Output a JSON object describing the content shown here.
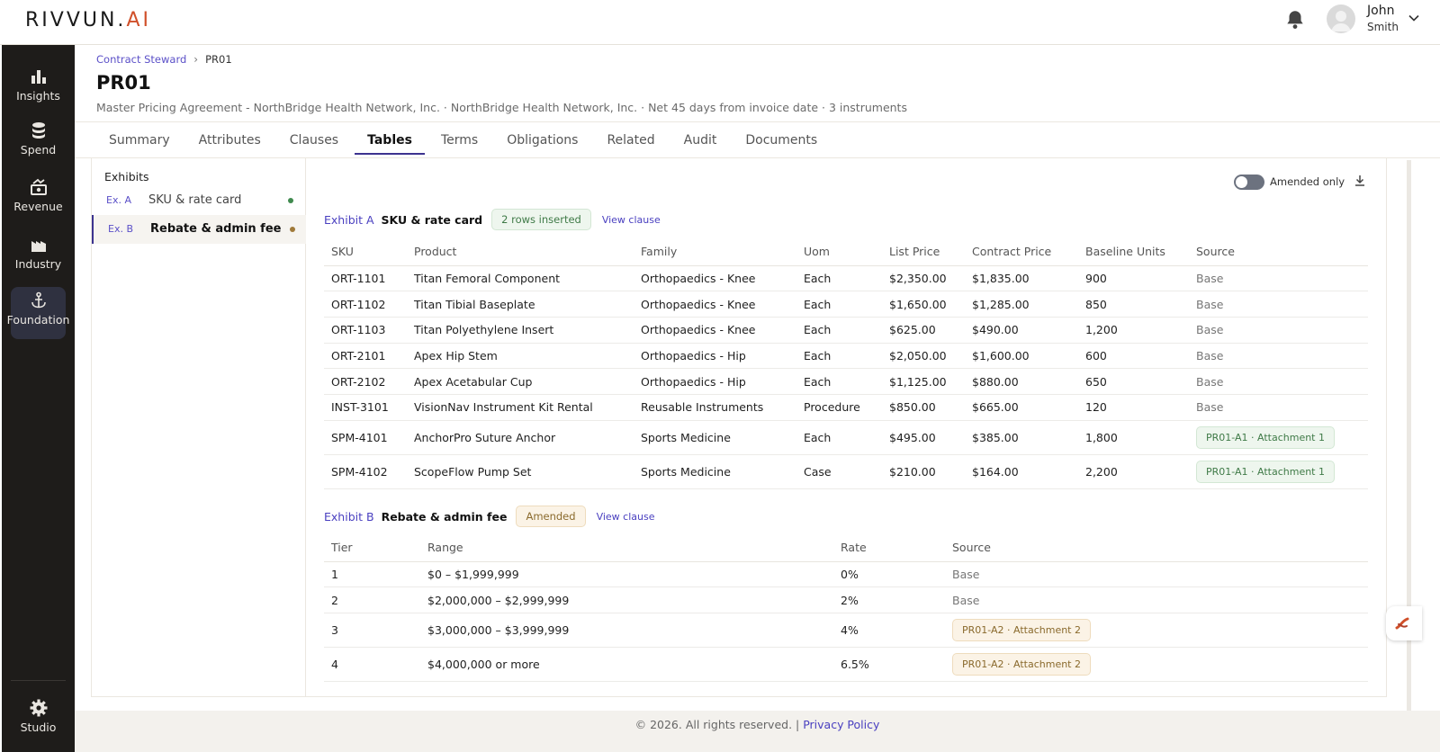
{
  "app": {
    "logo_main": "RIVVUN.",
    "logo_accent": "AI"
  },
  "user": {
    "first_name": "John",
    "last_name": "Smith"
  },
  "nav": {
    "items": [
      {
        "label": "Insights",
        "icon": "bar-chart-icon"
      },
      {
        "label": "Spend",
        "icon": "coins-icon"
      },
      {
        "label": "Revenue",
        "icon": "revenue-icon"
      },
      {
        "label": "Industry",
        "icon": "factory-icon"
      },
      {
        "label": "Foundation",
        "icon": "anchor-icon",
        "active": true
      }
    ],
    "studio_label": "Studio"
  },
  "breadcrumb": {
    "parent": "Contract Steward",
    "current": "PR01"
  },
  "page": {
    "title": "PR01",
    "subtitle": "Master Pricing Agreement - NorthBridge Health Network, Inc. · NorthBridge Health Network, Inc. · Net 45 days from invoice date · 3 instruments"
  },
  "tabs": [
    "Summary",
    "Attributes",
    "Clauses",
    "Tables",
    "Terms",
    "Obligations",
    "Related",
    "Audit",
    "Documents"
  ],
  "active_tab": "Tables",
  "exhibits": {
    "title": "Exhibits",
    "items": [
      {
        "code": "Ex. A",
        "name": "SKU & rate card",
        "dot_color": "#3f8a4e"
      },
      {
        "code": "Ex. B",
        "name": "Rebate & admin fee",
        "dot_color": "#a07a3a",
        "active": true
      }
    ]
  },
  "toolbar": {
    "toggle_label": "Amended only"
  },
  "exhibit_a": {
    "label": "Exhibit A",
    "name": "SKU & rate card",
    "badge": "2 rows inserted",
    "view_clause": "View clause",
    "columns": [
      "SKU",
      "Product",
      "Family",
      "Uom",
      "List Price",
      "Contract Price",
      "Baseline Units",
      "Source"
    ],
    "rows": [
      [
        "ORT-1101",
        "Titan Femoral Component",
        "Orthopaedics - Knee",
        "Each",
        "$2,350.00",
        "$1,835.00",
        "900",
        "Base"
      ],
      [
        "ORT-1102",
        "Titan Tibial Baseplate",
        "Orthopaedics - Knee",
        "Each",
        "$1,650.00",
        "$1,285.00",
        "850",
        "Base"
      ],
      [
        "ORT-1103",
        "Titan Polyethylene Insert",
        "Orthopaedics - Knee",
        "Each",
        "$625.00",
        "$490.00",
        "1,200",
        "Base"
      ],
      [
        "ORT-2101",
        "Apex Hip Stem",
        "Orthopaedics - Hip",
        "Each",
        "$2,050.00",
        "$1,600.00",
        "600",
        "Base"
      ],
      [
        "ORT-2102",
        "Apex Acetabular Cup",
        "Orthopaedics - Hip",
        "Each",
        "$1,125.00",
        "$880.00",
        "650",
        "Base"
      ],
      [
        "INST-3101",
        "VisionNav Instrument Kit Rental",
        "Reusable Instruments",
        "Procedure",
        "$850.00",
        "$665.00",
        "120",
        "Base"
      ],
      [
        "SPM-4101",
        "AnchorPro Suture Anchor",
        "Sports Medicine",
        "Each",
        "$495.00",
        "$385.00",
        "1,800",
        "PR01-A1 · Attachment 1"
      ],
      [
        "SPM-4102",
        "ScopeFlow Pump Set",
        "Sports Medicine",
        "Case",
        "$210.00",
        "$164.00",
        "2,200",
        "PR01-A1 · Attachment 1"
      ]
    ]
  },
  "exhibit_b": {
    "label": "Exhibit B",
    "name": "Rebate & admin fee",
    "badge": "Amended",
    "view_clause": "View clause",
    "columns": [
      "Tier",
      "Range",
      "Rate",
      "Source"
    ],
    "rows": [
      [
        "1",
        "$0 – $1,999,999",
        "0%",
        "Base"
      ],
      [
        "2",
        "$2,000,000 – $2,999,999",
        "2%",
        "Base"
      ],
      [
        "3",
        "$3,000,000 – $3,999,999",
        "4%",
        "PR01-A2 · Attachment 2"
      ],
      [
        "4",
        "$4,000,000 or more",
        "6.5%",
        "PR01-A2 · Attachment 2"
      ]
    ]
  },
  "footer": {
    "copyright": "© 2026. All rights reserved. | ",
    "privacy": "Privacy Policy"
  }
}
